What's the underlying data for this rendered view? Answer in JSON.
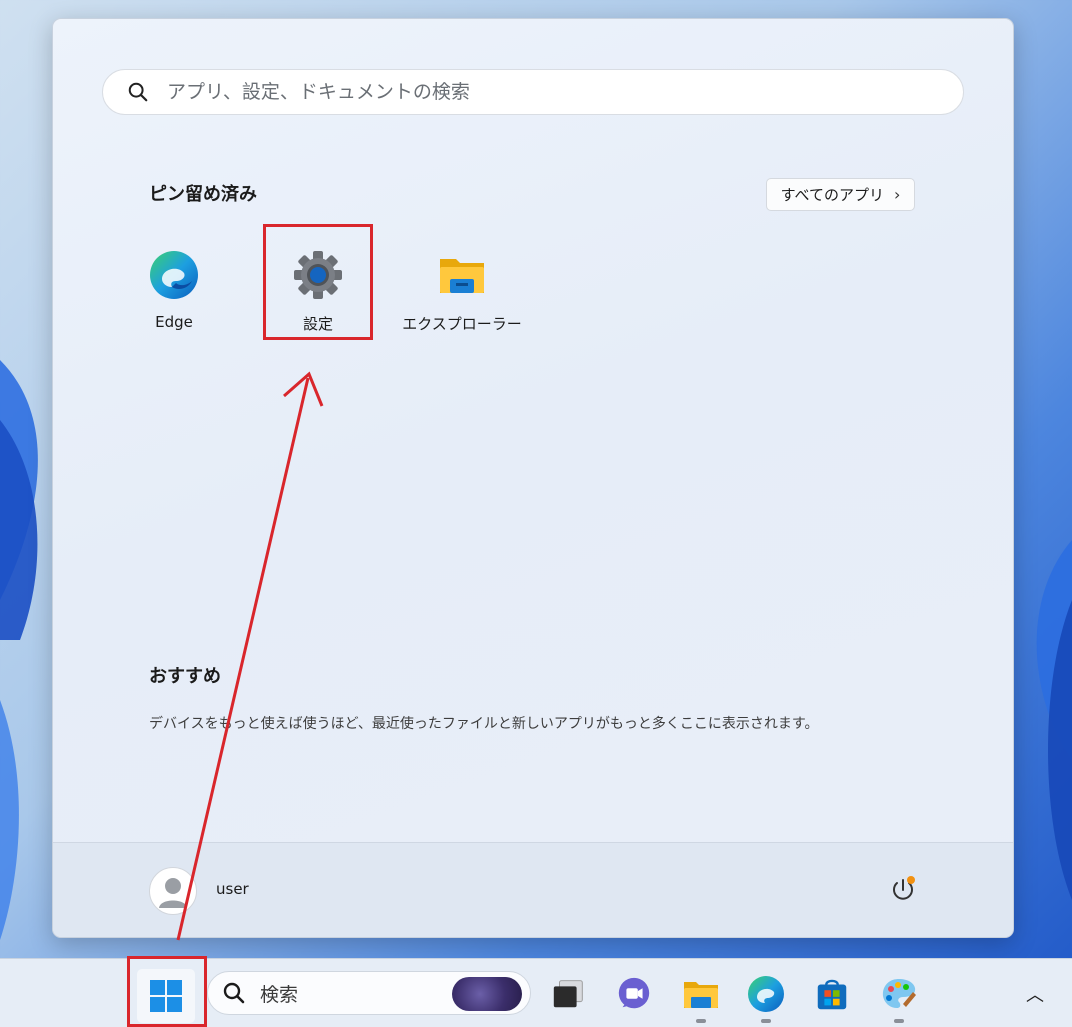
{
  "start_menu": {
    "search": {
      "placeholder": "アプリ、設定、ドキュメントの検索",
      "icon": "search-icon"
    },
    "pinned": {
      "title": "ピン留め済み",
      "all_apps_label": "すべてのアプリ",
      "apps": [
        {
          "label": "Edge",
          "icon": "edge-icon"
        },
        {
          "label": "設定",
          "icon": "settings-gear-icon"
        },
        {
          "label": "エクスプローラー",
          "icon": "folder-icon"
        }
      ]
    },
    "recommended": {
      "title": "おすすめ",
      "text": "デバイスをもっと使えば使うほど、最近使ったファイルと新しいアプリがもっと多くここに表示されます。"
    },
    "footer": {
      "username": "user",
      "power_icon": "power-icon"
    }
  },
  "taskbar": {
    "search_label": "検索",
    "apps": [
      {
        "name": "task-view-icon"
      },
      {
        "name": "teams-chat-icon"
      },
      {
        "name": "file-explorer-icon"
      },
      {
        "name": "edge-icon"
      },
      {
        "name": "microsoft-store-icon"
      },
      {
        "name": "paint-icon"
      }
    ]
  },
  "colors": {
    "annotation_red": "#d9262c",
    "accent_blue": "#0f6cbd"
  }
}
